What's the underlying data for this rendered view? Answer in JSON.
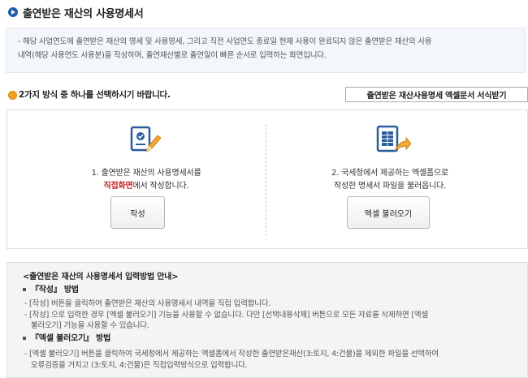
{
  "header": {
    "title": "출연받은 재산의 사용명세서"
  },
  "info": {
    "line1": "- 해당 사업연도에 출연받은 재산의 명세 및 사용명세, 그리고 직전 사업연도 종료일 현재 사용이 완료되지 않은 출연받은 재산의 사용",
    "line2": "내역(해당 사용연도 사용분)을 작성하며, 출연재산별로 출연일이 빠른 순서로 입력하는 화면입니다."
  },
  "choose": {
    "text": "2가지 방식 중 하나를 선택하시기 바랍니다.",
    "download_label": "출연받은 재산사용명세 엑셀문서 서식받기"
  },
  "options": {
    "write": {
      "line1": "1. 출연받은 재산의 사용명세서를",
      "line2_strong": "직접화면",
      "line2_rest": "에서 작성합니다.",
      "button_label": "작성",
      "icon": "document-pencil-icon"
    },
    "excel": {
      "line1": "2. 국세청에서 제공하는 엑셀폼으로",
      "line2": "작성한 명세서 파일을 불러옵니다.",
      "button_label": "엑셀 불러오기",
      "icon": "spreadsheet-import-icon"
    }
  },
  "guide": {
    "title": "<출연받은 재산의 사용명세서 입력방법 안내>",
    "section1_title": "『작성』 방법",
    "section1_lines": [
      "- [작성] 버튼을 클릭하여 출연받은 재산의 사용명세서 내역을 직접 입력합니다.",
      "- [작성] 으로 입력한 경우 [엑셀 불러오기] 기능을 사용할 수 없습니다. 다만 [선택내용삭제] 버튼으로 모든 자료를 삭제하면 [엑셀",
      "불러오기] 기능을 사용할 수 있습니다."
    ],
    "section2_title": "『엑셀 불러오기』 방법",
    "section2_lines": [
      "- [엑셀 불러오기] 버튼을 클릭하여 국세청에서 제공하는 엑셀폼에서 작성한 출연받은재산(3:토지, 4:건물)을 제외한 파일을 선택하여",
      "오류검증을 거치고 (3:토지, 4:건물)은 직접입력방식으로 입력합니다."
    ]
  },
  "colors": {
    "accent": "#1f5fa8",
    "highlight": "#c0282d",
    "dot": "#f0a020"
  }
}
